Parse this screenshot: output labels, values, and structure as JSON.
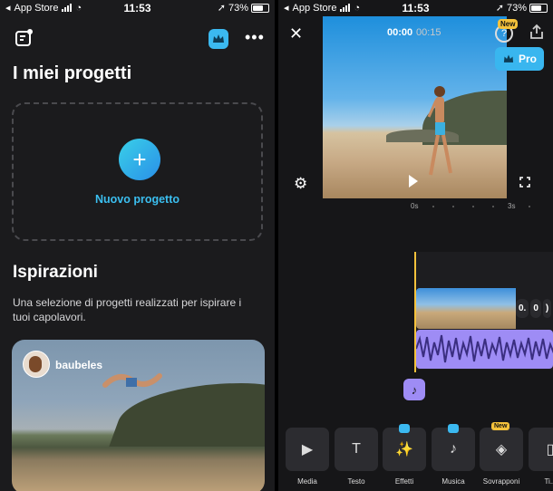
{
  "left": {
    "status": {
      "carrier": "App Store",
      "time": "11:53",
      "battery": "73%"
    },
    "title": "I miei progetti",
    "new_project": "Nuovo progetto",
    "section_title": "Ispirazioni",
    "section_desc": "Una selezione di progetti realizzati per ispirare i tuoi capolavori.",
    "card_user": "baubeles",
    "icons": [
      "menu-icon",
      "crown-icon",
      "more-icon",
      "plus-icon"
    ]
  },
  "right": {
    "status": {
      "carrier": "App Store",
      "time": "11:53",
      "battery": "73%"
    },
    "time_now": "00:00",
    "time_total": "00:15",
    "new_badge": "New",
    "help": "?",
    "pro": "Pro",
    "ruler": {
      "start": "0s",
      "mark": "3s"
    },
    "clip_controls": [
      "0.",
      "0",
      ")"
    ],
    "tools": [
      {
        "label": "Media",
        "icon": "media-icon",
        "glyph": "▶"
      },
      {
        "label": "Testo",
        "icon": "text-icon",
        "glyph": "T"
      },
      {
        "label": "Effetti",
        "icon": "effects-icon",
        "glyph": "✨",
        "premium": true
      },
      {
        "label": "Musica",
        "icon": "music-icon",
        "glyph": "♪",
        "premium": true
      },
      {
        "label": "Sovrapponi",
        "icon": "layers-icon",
        "glyph": "◈",
        "new": "New"
      },
      {
        "label": "Ti...",
        "icon": "more-tool-icon",
        "glyph": "▯"
      }
    ]
  }
}
